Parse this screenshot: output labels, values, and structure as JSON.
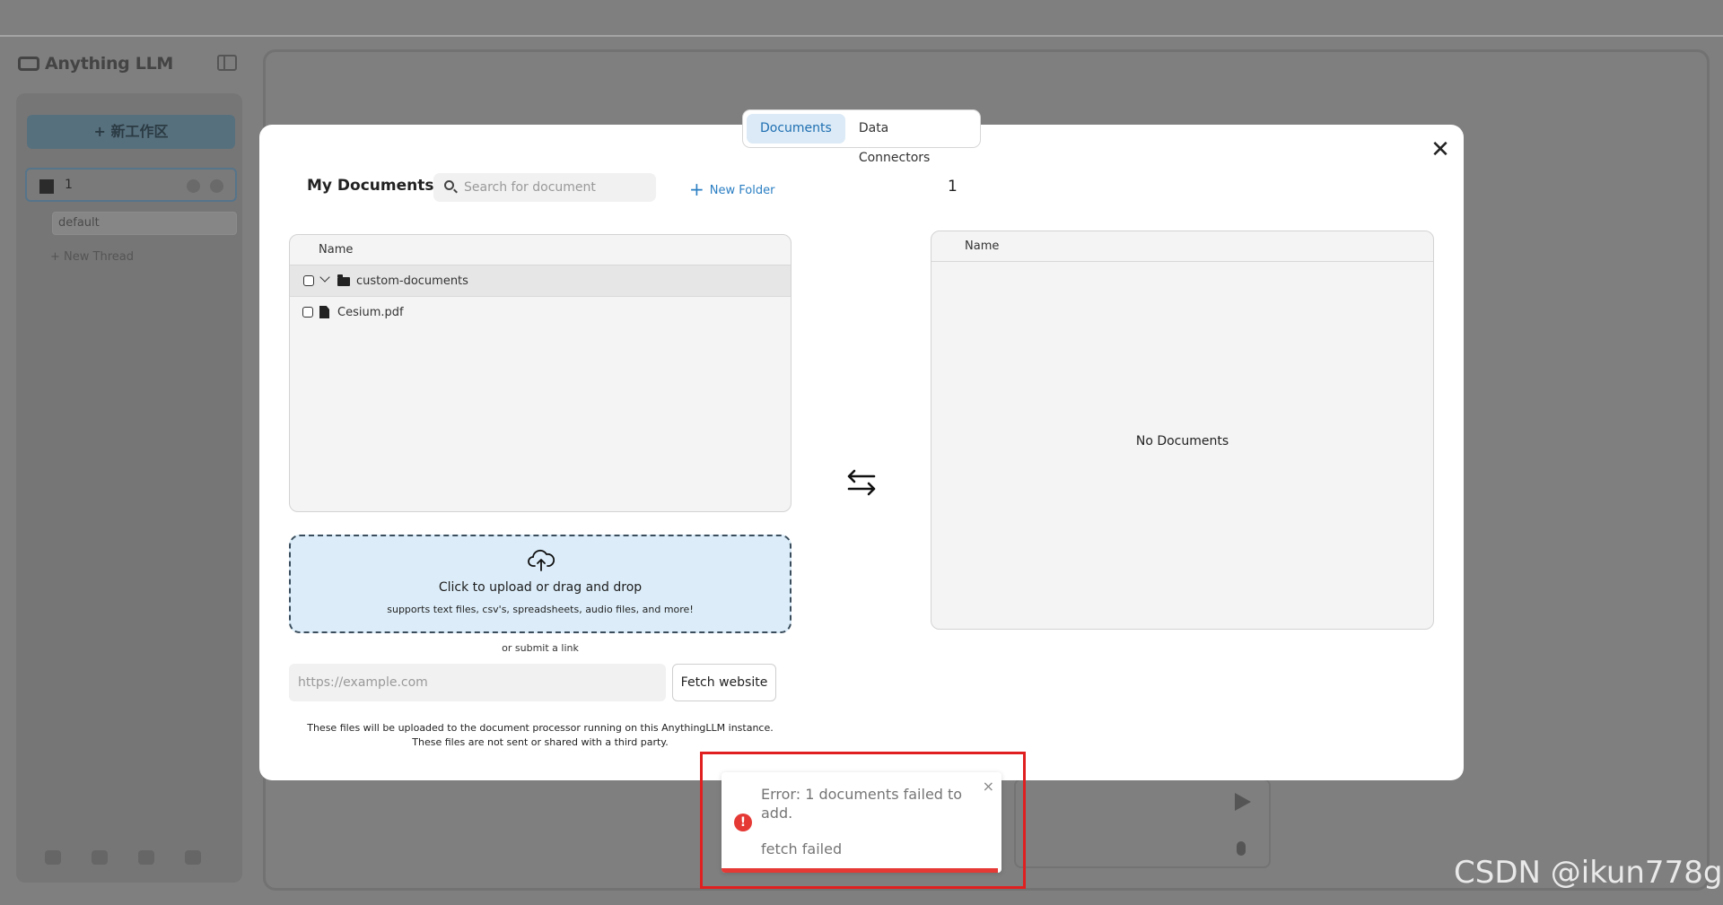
{
  "app": {
    "logo_text": "Anything LLM",
    "new_workspace_label": "+ 新工作区",
    "workspace_name": "1",
    "thread_name": "default",
    "new_thread_label": "+ New Thread"
  },
  "modal": {
    "tabs": [
      {
        "label": "Documents",
        "active": true
      },
      {
        "label": "Data Connectors",
        "active": false
      }
    ],
    "my_documents_title": "My Documents",
    "search_placeholder": "Search for document",
    "new_folder_label": "New Folder",
    "workspace_title": "1",
    "list_header": "Name",
    "folder_name": "custom-documents",
    "file_name": "Cesium.pdf",
    "workspace_list_header": "Name",
    "no_documents": "No Documents",
    "upload_title": "Click to upload or drag and drop",
    "upload_subtitle": "supports text files, csv's, spreadsheets, audio files, and more!",
    "or_link": "or submit a link",
    "url_placeholder": "https://example.com",
    "fetch_button": "Fetch website",
    "note_line1": "These files will be uploaded to the document processor running on this AnythingLLM instance.",
    "note_line2": "These files are not sent or shared with a third party."
  },
  "toast": {
    "message": "Error: 1 documents failed to add.",
    "detail": "fetch failed",
    "close": "×",
    "color": "#e53935"
  },
  "watermark": "CSDN @ikun778g"
}
